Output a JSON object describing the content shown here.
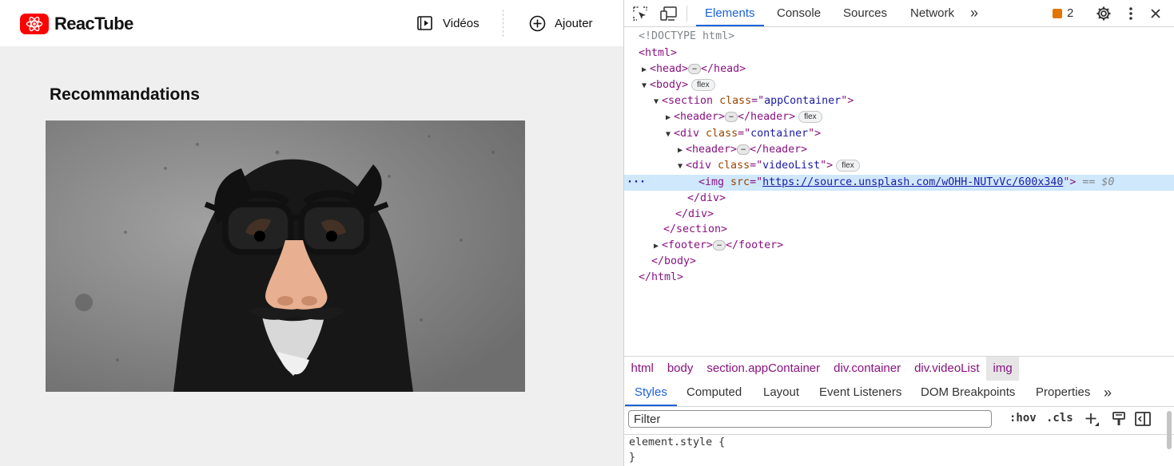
{
  "app": {
    "brand": "ReacTube",
    "nav": {
      "videos_label": "Vidéos",
      "add_label": "Ajouter"
    },
    "section_title": "Recommandations",
    "video_thumbnail": "dog-with-disguise-glasses"
  },
  "devtools": {
    "tabs": [
      "Elements",
      "Console",
      "Sources",
      "Network"
    ],
    "active_tab": "Elements",
    "more_tabs": "»",
    "issues_count": "2",
    "dom": {
      "doctype": "<!DOCTYPE html>",
      "html_open": "<html>",
      "head_open": "<head>",
      "head_close": "</head>",
      "body_open": "<body>",
      "section_tag": "<section",
      "attr_class": "class",
      "section_class": "appContainer",
      "header_open": "<header>",
      "header_close": "</header>",
      "div_tag": "<div",
      "container_class": "container",
      "videolist_class": "videoList",
      "img_tag": "<img",
      "attr_src": "src",
      "img_src": "https://source.unsplash.com/wOHH-NUTvVc/600x340",
      "selected_marker": "== $0",
      "div_close": "</div>",
      "section_close": "</section>",
      "footer_open": "<footer>",
      "footer_close": "</footer>",
      "body_close": "</body>",
      "html_close": "</html>",
      "flex_badge": "flex"
    },
    "breadcrumbs": [
      "html",
      "body",
      "section.appContainer",
      "div.container",
      "div.videoList",
      "img"
    ],
    "sub_tabs": [
      "Styles",
      "Computed",
      "Layout",
      "Event Listeners",
      "DOM Breakpoints",
      "Properties"
    ],
    "active_sub_tab": "Styles",
    "filter_placeholder": "Filter",
    "hov_label": ":hov",
    "cls_label": ".cls",
    "styles": {
      "selector": "element.style {",
      "close": "}"
    }
  },
  "colors": {
    "brand_red": "#ff0000",
    "accent_blue": "#1a62d8",
    "tag_purple": "#881280",
    "attr_orange": "#994500",
    "value_blue": "#1a1aa6"
  }
}
